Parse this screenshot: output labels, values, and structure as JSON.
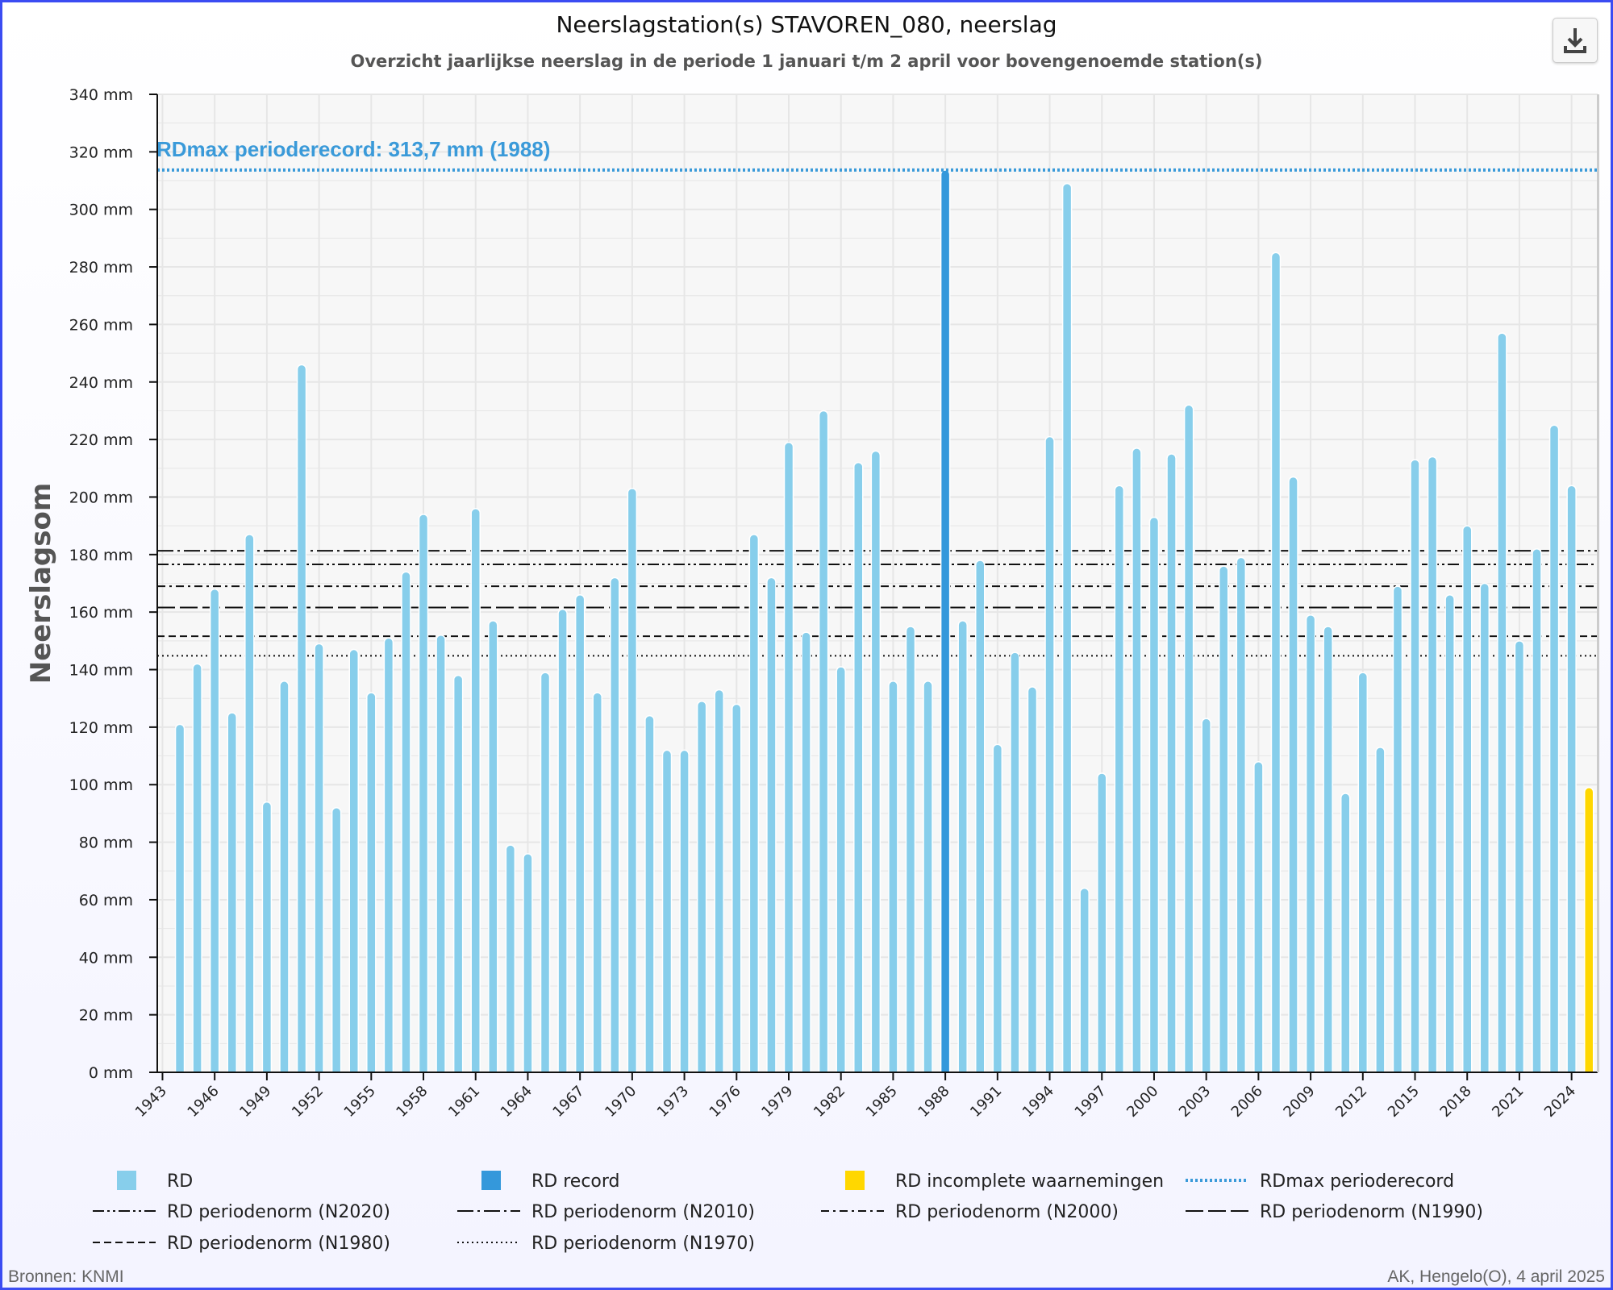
{
  "header": {
    "title": "Neerslagstation(s) STAVOREN_080, neerslag",
    "subtitle": "Overzicht jaarlijkse neerslag in de periode 1 januari t/m 2 april voor bovengenoemde station(s)",
    "download_icon": "download-icon"
  },
  "footer": {
    "left": "Bronnen: KNMI",
    "right": "AK, Hengelo(O), 4 april 2025"
  },
  "chart_data": {
    "type": "bar",
    "ylabel": "Neerslagsom",
    "ylim": [
      0,
      340
    ],
    "yticks": [
      "0 mm",
      "20 mm",
      "40 mm",
      "60 mm",
      "80 mm",
      "100 mm",
      "120 mm",
      "140 mm",
      "160 mm",
      "180 mm",
      "200 mm",
      "220 mm",
      "240 mm",
      "260 mm",
      "280 mm",
      "300 mm",
      "320 mm",
      "340 mm"
    ],
    "xticks": [
      "1943",
      "1946",
      "1949",
      "1952",
      "1955",
      "1958",
      "1961",
      "1964",
      "1967",
      "1970",
      "1973",
      "1976",
      "1979",
      "1982",
      "1985",
      "1988",
      "1991",
      "1994",
      "1997",
      "2000",
      "2003",
      "2006",
      "2009",
      "2012",
      "2015",
      "2018",
      "2021",
      "2024"
    ],
    "grid": true,
    "legend_placement": "bottom",
    "years": [
      1944,
      1945,
      1946,
      1947,
      1948,
      1949,
      1950,
      1951,
      1952,
      1953,
      1954,
      1955,
      1956,
      1957,
      1958,
      1959,
      1960,
      1961,
      1962,
      1963,
      1964,
      1965,
      1966,
      1967,
      1968,
      1969,
      1970,
      1971,
      1972,
      1973,
      1974,
      1975,
      1976,
      1977,
      1978,
      1979,
      1980,
      1981,
      1982,
      1983,
      1984,
      1985,
      1986,
      1987,
      1988,
      1989,
      1990,
      1991,
      1992,
      1993,
      1994,
      1995,
      1996,
      1997,
      1998,
      1999,
      2000,
      2001,
      2002,
      2003,
      2004,
      2005,
      2006,
      2007,
      2008,
      2009,
      2010,
      2011,
      2012,
      2013,
      2014,
      2015,
      2016,
      2017,
      2018,
      2019,
      2020,
      2021,
      2022,
      2023,
      2024,
      2025
    ],
    "values": [
      121,
      142,
      168,
      125,
      187,
      94,
      136,
      246,
      149,
      92,
      147,
      132,
      151,
      174,
      194,
      152,
      138,
      196,
      157,
      79,
      76,
      139,
      161,
      166,
      132,
      172,
      203,
      124,
      112,
      112,
      129,
      133,
      128,
      187,
      172,
      219,
      153,
      230,
      141,
      212,
      216,
      136,
      155,
      136,
      313.7,
      157,
      178,
      114,
      146,
      134,
      221,
      309,
      64,
      104,
      204,
      217,
      193,
      215,
      232,
      123,
      176,
      179,
      108,
      285,
      207,
      159,
      155,
      97,
      139,
      113,
      169,
      213,
      214,
      166,
      190,
      170,
      257,
      150,
      182,
      225,
      204,
      99
    ],
    "record_year": 1988,
    "incomplete_year": 2025,
    "colors": {
      "RD": "#87ceeb",
      "RD record": "#3498db",
      "RD incomplete": "#ffd700",
      "record_line": "#3a9ad9"
    },
    "record": {
      "label": "RDmax perioderecord: 313,7 mm (1988)",
      "value": 313.7
    },
    "norms": [
      {
        "name": "RD periodenorm (N2020)",
        "value": 176.6,
        "dash": "14 4 3 4 3 4"
      },
      {
        "name": "RD periodenorm (N2010)",
        "value": 181.3,
        "dash": "20 5 3 5"
      },
      {
        "name": "RD periodenorm (N2000)",
        "value": 169,
        "dash": "10 5 3 5"
      },
      {
        "name": "RD periodenorm (N1990)",
        "value": 161.6,
        "dash": "22 6"
      },
      {
        "name": "RD periodenorm (N1980)",
        "value": 151.6,
        "dash": "9 5"
      },
      {
        "name": "RD periodenorm (N1970)",
        "value": 144.8,
        "dash": "2 4"
      }
    ],
    "legend": [
      "RD",
      "RD record",
      "RD incomplete waarnemingen",
      "RDmax perioderecord",
      "RD periodenorm (N2020)",
      "RD periodenorm (N2010)",
      "RD periodenorm (N2000)",
      "RD periodenorm (N1990)",
      "RD periodenorm (N1980)",
      "RD periodenorm (N1970)"
    ]
  }
}
